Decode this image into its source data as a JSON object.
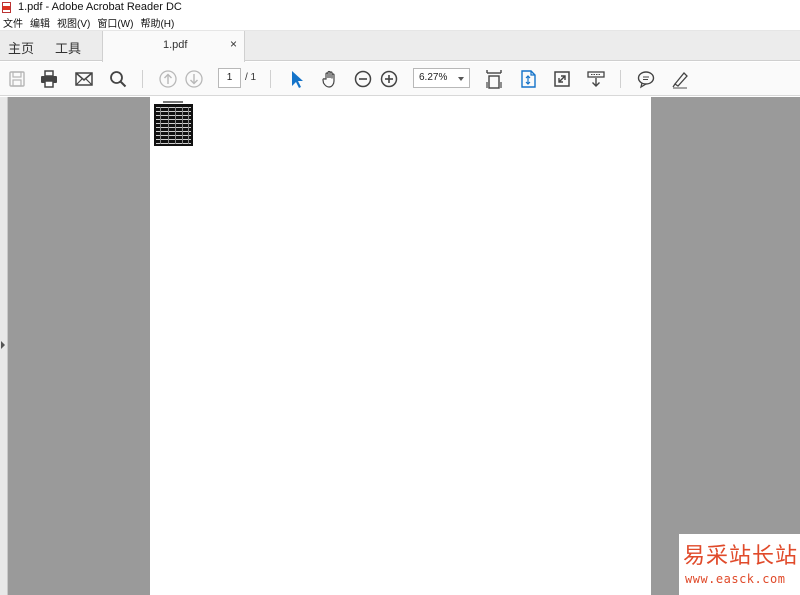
{
  "window": {
    "title": "1.pdf - Adobe Acrobat Reader DC"
  },
  "menubar": {
    "items": [
      {
        "label": "文件"
      },
      {
        "label": "编辑"
      },
      {
        "label": "视图(V)"
      },
      {
        "label": "窗口(W)"
      },
      {
        "label": "帮助(H)"
      }
    ]
  },
  "tabs": {
    "home_label": "主页",
    "tools_label": "工具",
    "document_label": "1.pdf",
    "close_glyph": "×"
  },
  "toolbar": {
    "icons": [
      "save-icon",
      "print-icon",
      "email-icon",
      "search-icon",
      "previous-page-icon",
      "next-page-icon",
      "select-tool-icon",
      "hand-tool-icon",
      "zoom-out-icon",
      "zoom-in-icon",
      "fit-page-icon",
      "page-layout-icon",
      "full-screen-icon",
      "scroll-mode-icon",
      "comment-icon",
      "highlight-icon"
    ],
    "current_page": "1",
    "page_total": "/ 1",
    "zoom": "6.27%"
  },
  "watermark": {
    "text_cn": "易采站长站",
    "url": "www.easck.com"
  },
  "colors": {
    "viewer_background": "#9a9a9a",
    "accent_blue": "#1473c9",
    "watermark_red": "#e04a2a"
  }
}
